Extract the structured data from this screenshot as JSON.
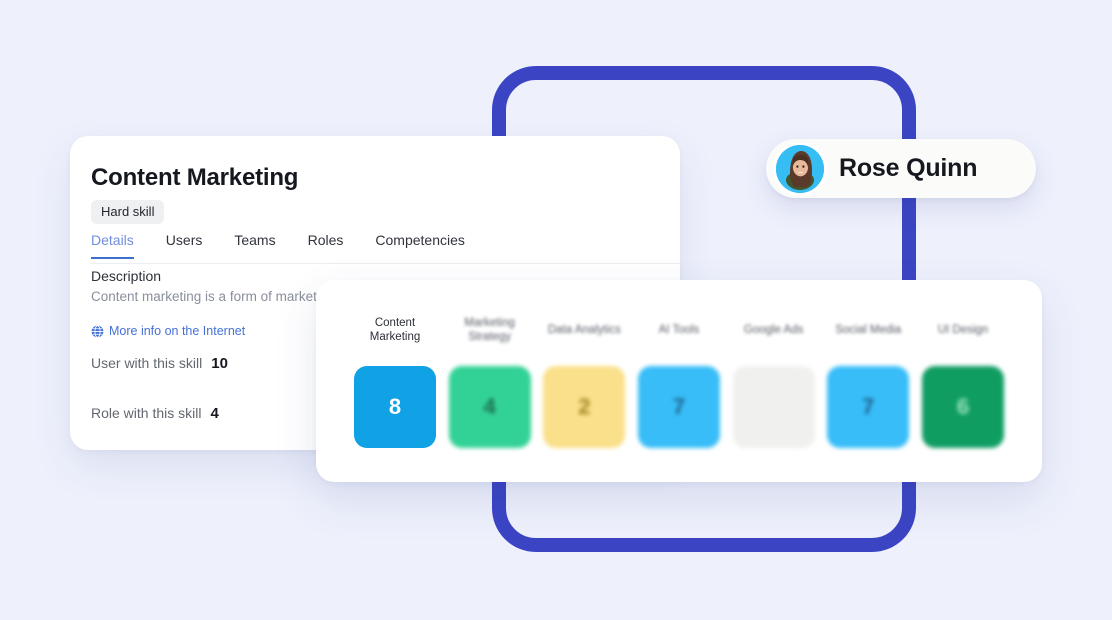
{
  "page": {
    "background_color": "#eef1fc",
    "frame_color": "#3b45c4"
  },
  "detail_card": {
    "title": "Content Marketing",
    "badge": "Hard skill",
    "tabs": [
      {
        "label": "Details",
        "active": true
      },
      {
        "label": "Users",
        "active": false
      },
      {
        "label": "Teams",
        "active": false
      },
      {
        "label": "Roles",
        "active": false
      },
      {
        "label": "Competencies",
        "active": false
      }
    ],
    "description_label": "Description",
    "description_text": "Content marketing is a form of marketing content for a targeted audience online. It",
    "more_info_link": "More info on the Internet",
    "more_info_icon": "globe-icon",
    "stats": [
      {
        "label": "User with this skill",
        "value": "10"
      },
      {
        "label": "Role with this skill",
        "value": "4"
      }
    ]
  },
  "user_chip": {
    "name": "Rose Quinn",
    "avatar_icon": "avatar",
    "avatar_bg": "#36bdf4"
  },
  "chart_data": {
    "type": "bar",
    "title": "",
    "xlabel": "",
    "ylabel": "",
    "categories": [
      "Content Marketing",
      "Marketing Strategy",
      "Data Analytics",
      "AI Tools",
      "Google Ads",
      "Social Media",
      "UI Design"
    ],
    "values": [
      8,
      4,
      2,
      7,
      null,
      7,
      6
    ],
    "value_labels": [
      "8",
      "4",
      "2",
      "7",
      "",
      "7",
      "6"
    ],
    "colors": [
      "#11a1e5",
      "#32d296",
      "#fae08a",
      "#38bdf8",
      "#f0f0ef",
      "#38bdf8",
      "#0f9d62"
    ],
    "text_colors": [
      "#ffffff",
      "#1d6b4e",
      "#a08020",
      "#1d5f84",
      "#b9bcc2",
      "#1d5f84",
      "#9fe3c4"
    ],
    "blurred": [
      false,
      true,
      true,
      true,
      true,
      true,
      true
    ],
    "grid": false,
    "legend": "none"
  }
}
